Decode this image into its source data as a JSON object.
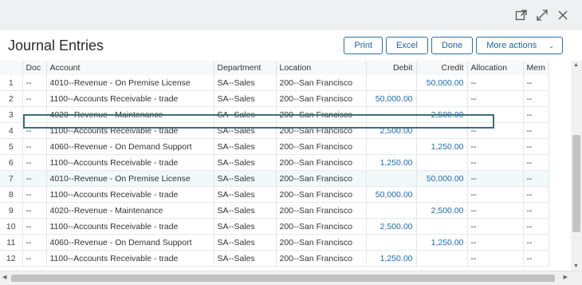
{
  "window": {
    "icons": [
      "open-in-new-window-icon",
      "expand-icon",
      "close-icon"
    ]
  },
  "header": {
    "title": "Journal Entries",
    "buttons": {
      "print": "Print",
      "excel": "Excel",
      "done": "Done",
      "more": "More actions",
      "more_chevron": "⌄"
    }
  },
  "table": {
    "columns": [
      "",
      "Doc",
      "Account",
      "Department",
      "Location",
      "Debit",
      "Credit",
      "Allocation",
      "Mem"
    ],
    "rows": [
      [
        "1",
        "--",
        "4010--Revenue - On Premise License",
        "SA--Sales",
        "200--San Francisco",
        "",
        "50,000.00",
        "--",
        "--"
      ],
      [
        "2",
        "--",
        "1100--Accounts Receivable - trade",
        "SA--Sales",
        "200--San Francisco",
        "50,000.00",
        "",
        "--",
        "--"
      ],
      [
        "3",
        "--",
        "4020--Revenue - Maintenance",
        "SA--Sales",
        "200--San Francisco",
        "",
        "2,500.00",
        "--",
        "--"
      ],
      [
        "4",
        "--",
        "1100--Accounts Receivable - trade",
        "SA--Sales",
        "200--San Francisco",
        "2,500.00",
        "",
        "--",
        "--"
      ],
      [
        "5",
        "--",
        "4060--Revenue - On Demand Support",
        "SA--Sales",
        "200--San Francisco",
        "",
        "1,250.00",
        "--",
        "--"
      ],
      [
        "6",
        "--",
        "1100--Accounts Receivable - trade",
        "SA--Sales",
        "200--San Francisco",
        "1,250.00",
        "",
        "--",
        "--"
      ],
      [
        "7",
        "--",
        "4010--Revenue - On Premise License",
        "SA--Sales",
        "200--San Francisco",
        "",
        "50,000.00",
        "--",
        "--"
      ],
      [
        "8",
        "--",
        "1100--Accounts Receivable - trade",
        "SA--Sales",
        "200--San Francisco",
        "50,000.00",
        "",
        "--",
        "--"
      ],
      [
        "9",
        "--",
        "4020--Revenue - Maintenance",
        "SA--Sales",
        "200--San Francisco",
        "",
        "2,500.00",
        "--",
        "--"
      ],
      [
        "10",
        "--",
        "1100--Accounts Receivable - trade",
        "SA--Sales",
        "200--San Francisco",
        "2,500.00",
        "",
        "--",
        "--"
      ],
      [
        "11",
        "--",
        "4060--Revenue - On Demand Support",
        "SA--Sales",
        "200--San Francisco",
        "",
        "1,250.00",
        "--",
        "--"
      ],
      [
        "12",
        "--",
        "1100--Accounts Receivable - trade",
        "SA--Sales",
        "200--San Francisco",
        "1,250.00",
        "",
        "--",
        "--"
      ]
    ],
    "selected_row": "7"
  },
  "colors": {
    "accent": "#1f6ab3",
    "selection_border": "#3b6e78",
    "topbar": "#eef0f1"
  }
}
